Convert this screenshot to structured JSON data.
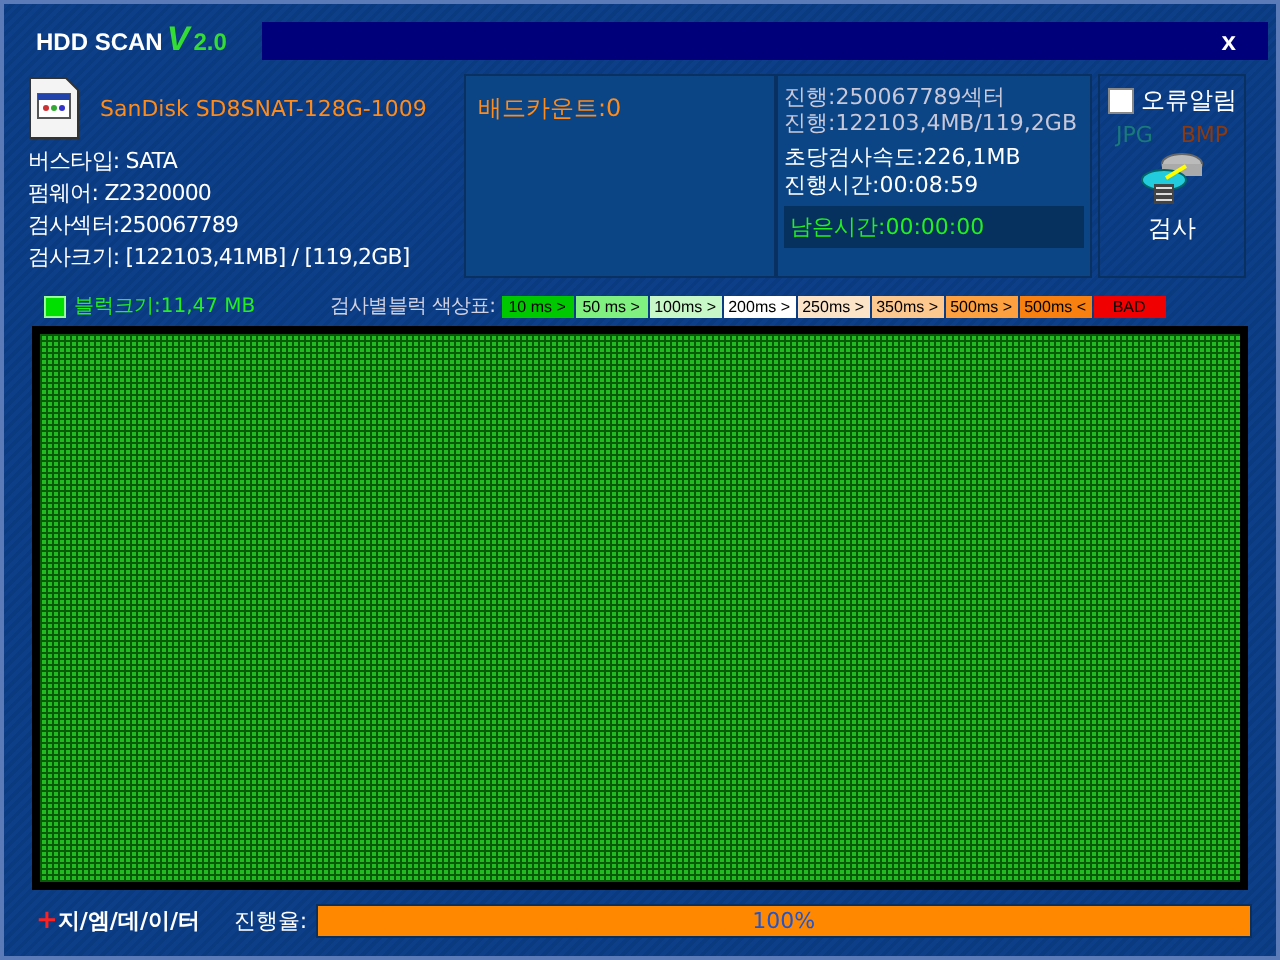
{
  "window": {
    "title": "HDD SCAN",
    "version_letter": "V",
    "version": "2.0",
    "close": "x"
  },
  "drive": {
    "model": "SanDisk SD8SNAT-128G-1009",
    "info": [
      "버스타입: SATA",
      "펌웨어: Z2320000",
      "검사섹터:250067789",
      "검사크기: [122103,41MB] / [119,2GB]"
    ]
  },
  "bad_count": "배드카운트:0",
  "progress_info": {
    "lines": [
      "진행:250067789섹터",
      "진행:122103,4MB/119,2GB"
    ],
    "speed": "초당검사속도:226,1MB",
    "elapsed": "진행시간:00:08:59",
    "remaining": "남은시간:00:00:00"
  },
  "options": {
    "error_alarm": {
      "label": "오류알림",
      "checked": false
    },
    "formats": [
      {
        "label": "JPG",
        "color": "#1a7a7a"
      },
      {
        "label": "BMP",
        "color": "#8a3a10"
      }
    ],
    "scan_button": "검사"
  },
  "legend": {
    "block_size": "블럭크기:11,47 MB",
    "title": "검사별블럭 색상표:",
    "items": [
      {
        "label": "10 ms >",
        "color": "#00c800"
      },
      {
        "label": "50 ms >",
        "color": "#80f080"
      },
      {
        "label": "100ms >",
        "color": "#c8f8c8"
      },
      {
        "label": "200ms >",
        "color": "#ffffff"
      },
      {
        "label": "250ms >",
        "color": "#fce4c8"
      },
      {
        "label": "350ms >",
        "color": "#fcc890"
      },
      {
        "label": "500ms >",
        "color": "#fca040"
      },
      {
        "label": "500ms <",
        "color": "#f88010"
      },
      {
        "label": "BAD",
        "color": "#f00000"
      }
    ]
  },
  "footer": {
    "brand_mark": "+",
    "brand": "지/엠/데/이/터",
    "progress_label": "진행율:",
    "progress_text": "100%",
    "level": 1
  }
}
